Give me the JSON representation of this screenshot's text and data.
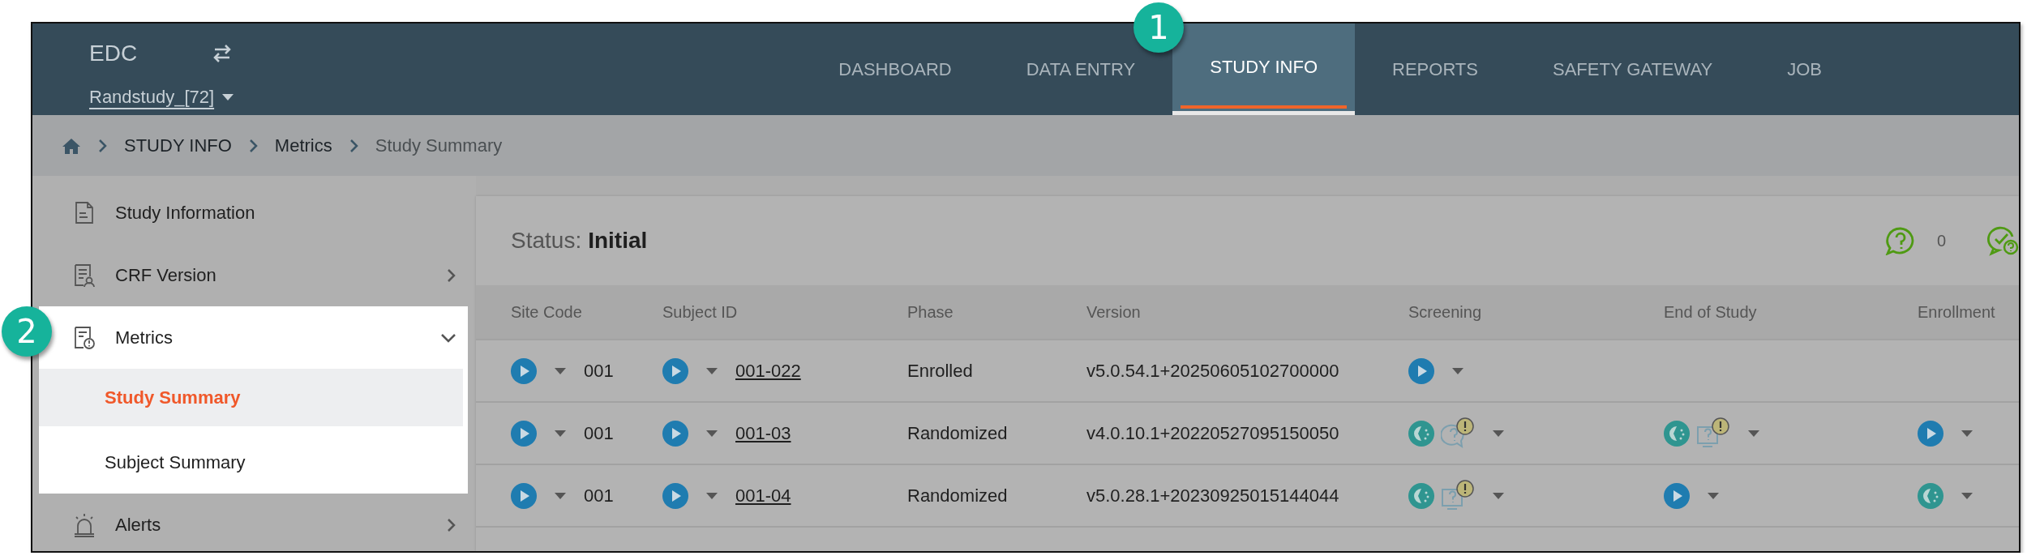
{
  "app": {
    "title": "EDC",
    "study": "Randstudy_[72]"
  },
  "nav_tabs": [
    {
      "label": "DASHBOARD",
      "selected": false
    },
    {
      "label": "DATA ENTRY",
      "selected": false
    },
    {
      "label": "STUDY INFO",
      "selected": true
    },
    {
      "label": "REPORTS",
      "selected": false
    },
    {
      "label": "SAFETY GATEWAY",
      "selected": false
    },
    {
      "label": "JOB",
      "selected": false
    }
  ],
  "breadcrumb": [
    "STUDY INFO",
    "Metrics",
    "Study Summary"
  ],
  "sidebar": {
    "items": [
      {
        "label": "Study Information",
        "kind": "document",
        "expandable": false,
        "selected": false
      },
      {
        "label": "CRF Version",
        "kind": "crf",
        "expandable": true,
        "expanded": false,
        "selected": false
      },
      {
        "label": "Metrics",
        "kind": "metrics",
        "expandable": true,
        "expanded": true,
        "selected": true,
        "children": [
          {
            "label": "Study Summary",
            "selected": true
          },
          {
            "label": "Subject Summary",
            "selected": false
          }
        ]
      },
      {
        "label": "Alerts",
        "kind": "alert",
        "expandable": true,
        "expanded": false,
        "selected": false
      }
    ]
  },
  "callouts": [
    {
      "label": "1"
    },
    {
      "label": "2"
    }
  ],
  "status": {
    "label": "Status:",
    "value": "Initial",
    "counters": [
      {
        "kind": "question",
        "count": "0"
      },
      {
        "kind": "answered"
      }
    ]
  },
  "table": {
    "columns": [
      "Site Code",
      "Subject ID",
      "Phase",
      "Version",
      "Screening",
      "End of Study",
      "Enrollment"
    ],
    "rows": [
      {
        "site_code": "001",
        "subject_id": "001-022",
        "phase": "Enrolled",
        "version": "v5.0.54.1+20250605102700000",
        "visits": [
          {
            "kind": "filled",
            "icons": [
              {
                "kind": "play"
              }
            ]
          },
          {
            "kind": "empty"
          },
          {
            "kind": "empty"
          }
        ]
      },
      {
        "site_code": "001",
        "subject_id": "001-03",
        "phase": "Randomized",
        "version": "v4.0.10.1+20220527095150050",
        "visits": [
          {
            "kind": "filled",
            "icons": [
              {
                "kind": "partial"
              },
              {
                "kind": "bubble"
              }
            ]
          },
          {
            "kind": "filled",
            "icons": [
              {
                "kind": "partial"
              },
              {
                "kind": "monitor"
              }
            ]
          },
          {
            "kind": "filled",
            "icons": [
              {
                "kind": "play"
              }
            ]
          }
        ]
      },
      {
        "site_code": "001",
        "subject_id": "001-04",
        "phase": "Randomized",
        "version": "v5.0.28.1+20230925015144044",
        "visits": [
          {
            "kind": "filled",
            "icons": [
              {
                "kind": "partial"
              },
              {
                "kind": "monitor"
              }
            ]
          },
          {
            "kind": "filled",
            "icons": [
              {
                "kind": "play"
              }
            ]
          },
          {
            "kind": "filled",
            "icons": [
              {
                "kind": "partial"
              }
            ]
          }
        ]
      }
    ]
  }
}
